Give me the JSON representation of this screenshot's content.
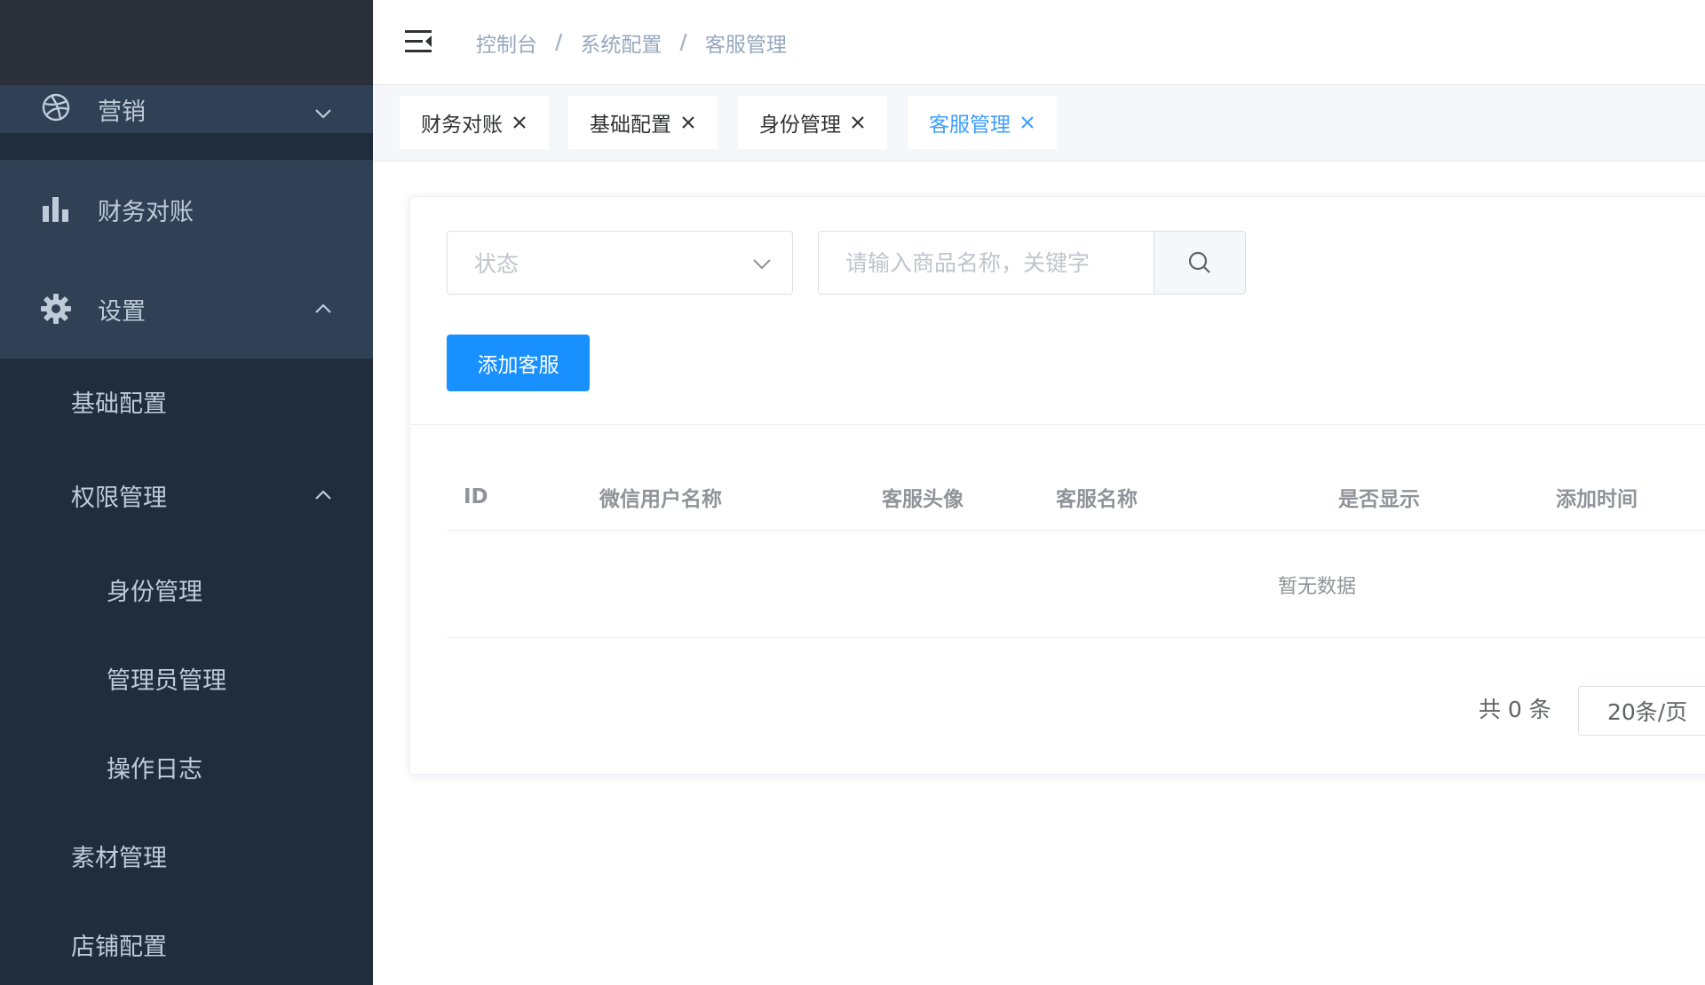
{
  "sidebar": {
    "marketing": {
      "label": "营销",
      "icon": "dribbble-icon"
    },
    "finance": {
      "label": "财务对账",
      "icon": "bar-chart-icon"
    },
    "settings": {
      "label": "设置",
      "icon": "gear-icon"
    },
    "sub": {
      "basic_config": "基础配置",
      "permission": "权限管理",
      "identity": "身份管理",
      "admin": "管理员管理",
      "log": "操作日志",
      "material": "素材管理",
      "shop_config": "店铺配置"
    }
  },
  "header": {
    "breadcrumb": [
      "控制台",
      "系统配置",
      "客服管理"
    ]
  },
  "tags": [
    {
      "label": "财务对账",
      "active": false
    },
    {
      "label": "基础配置",
      "active": false
    },
    {
      "label": "身份管理",
      "active": false
    },
    {
      "label": "客服管理",
      "active": true
    }
  ],
  "filters": {
    "status_placeholder": "状态",
    "search_placeholder": "请输入商品名称，关键字"
  },
  "actions": {
    "add_label": "添加客服"
  },
  "table": {
    "columns": [
      "ID",
      "微信用户名称",
      "客服头像",
      "客服名称",
      "是否显示",
      "添加时间"
    ],
    "empty_text": "暂无数据"
  },
  "pagination": {
    "total_text": "共 0 条",
    "page_size": "20条/页"
  },
  "colors": {
    "sidebar_bg": "#1f2d3d",
    "sidebar_active_bg": "#304156",
    "primary": "#1890ff",
    "tag_active": "#409eff"
  }
}
